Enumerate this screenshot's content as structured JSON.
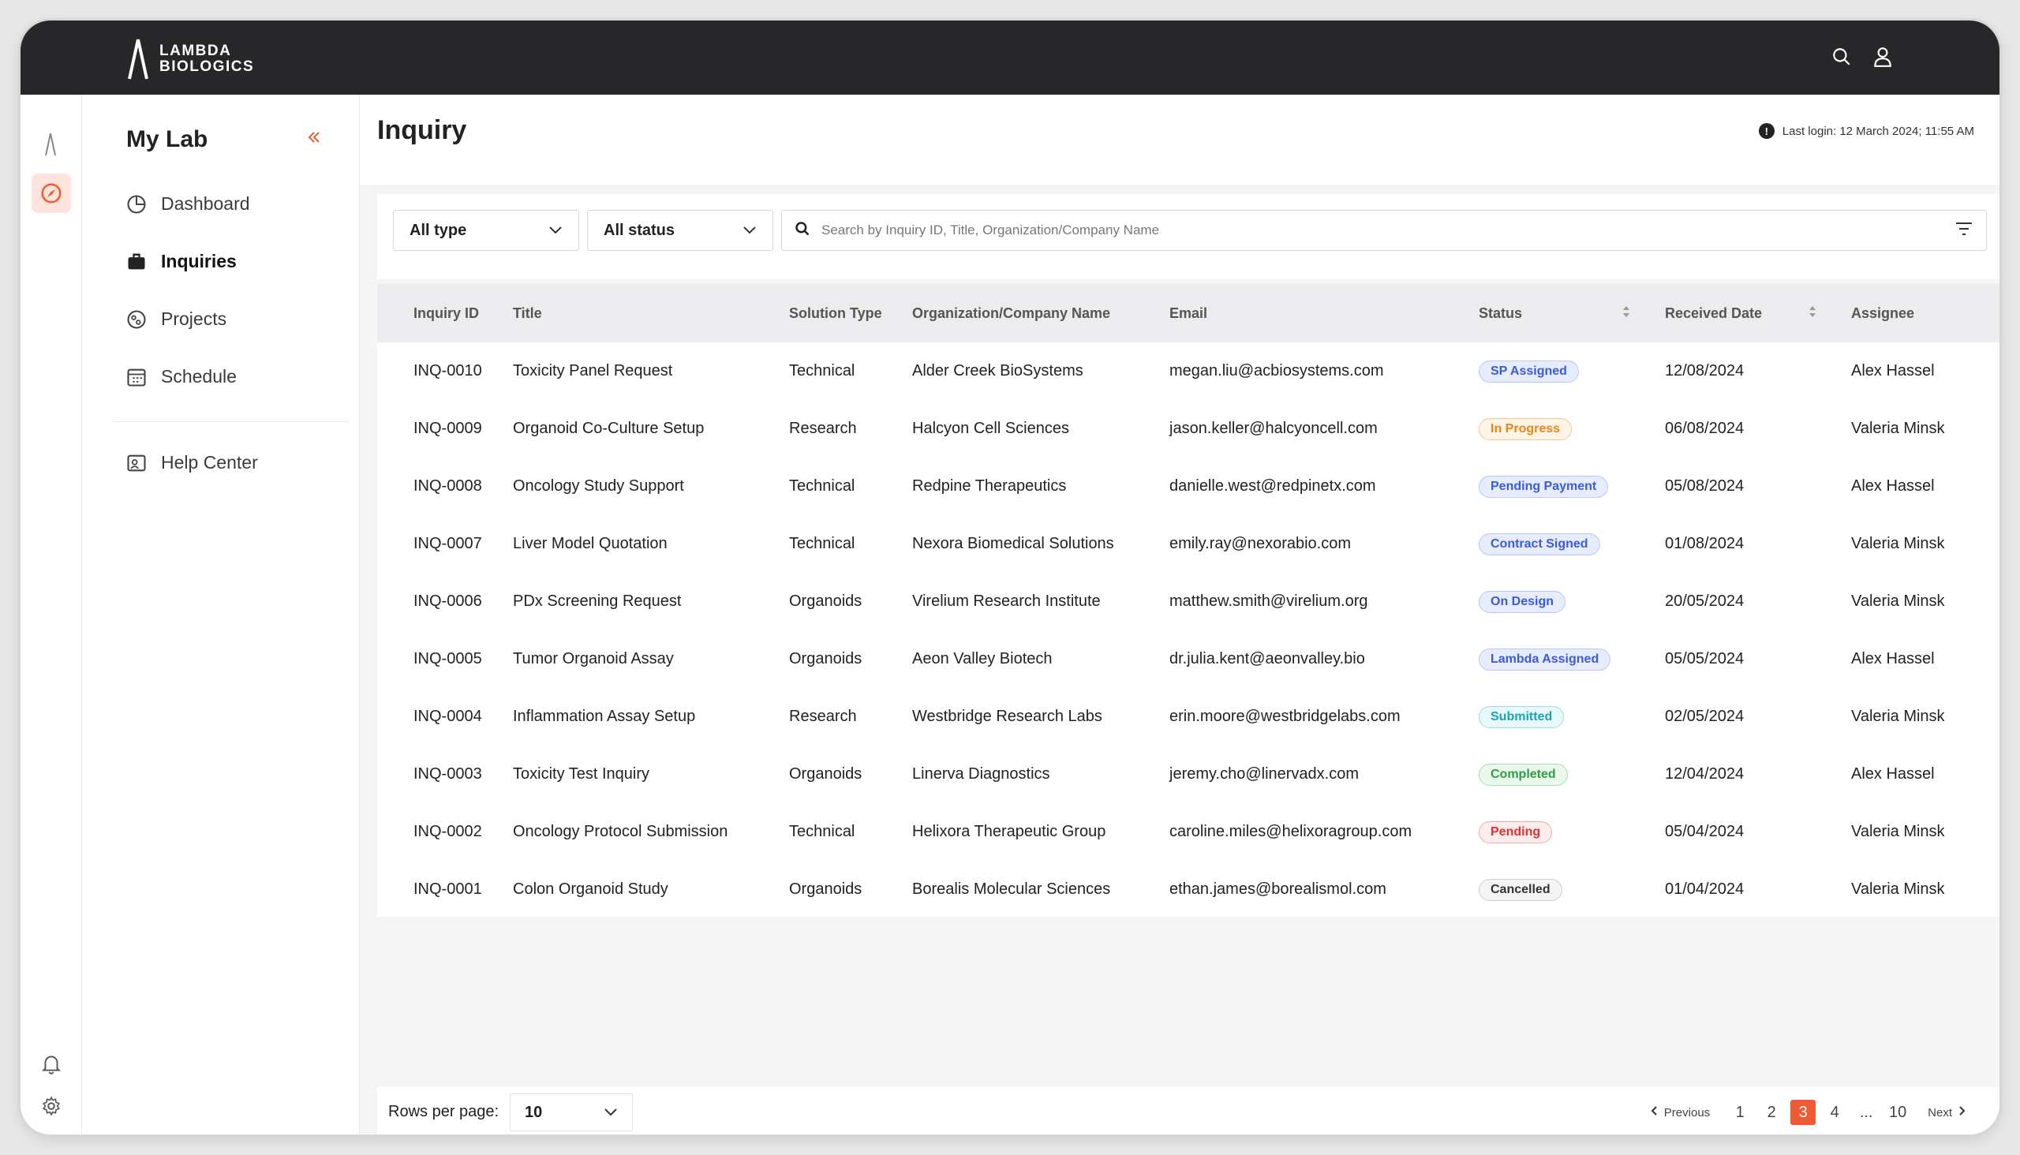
{
  "brand": {
    "line1": "LAMBDA",
    "line2": "BIOLOGICS"
  },
  "sidebar": {
    "title": "My Lab",
    "items": [
      {
        "label": "Dashboard",
        "icon": "dashboard-icon"
      },
      {
        "label": "Inquiries",
        "icon": "briefcase-icon",
        "active": true
      },
      {
        "label": "Projects",
        "icon": "projects-icon"
      },
      {
        "label": "Schedule",
        "icon": "calendar-icon"
      }
    ],
    "help": {
      "label": "Help Center",
      "icon": "help-center-icon"
    }
  },
  "header": {
    "title": "Inquiry",
    "last_login": "Last login: 12 March 2024; 11:55 AM"
  },
  "filters": {
    "type": "All type",
    "status": "All status",
    "search_placeholder": "Search by Inquiry ID, Title, Organization/Company Name"
  },
  "table": {
    "headers": {
      "id": "Inquiry ID",
      "title": "Title",
      "type": "Solution Type",
      "org": "Organization/Company Name",
      "email": "Email",
      "status": "Status",
      "date": "Received Date",
      "assignee": "Assignee"
    },
    "rows": [
      {
        "id": "INQ-0010",
        "title": "Toxicity Panel Request",
        "type": "Technical",
        "org": "Alder Creek BioSystems",
        "email": "megan.liu@acbiosystems.com",
        "status": "SP Assigned",
        "date": "12/08/2024",
        "assignee": "Alex Hassel"
      },
      {
        "id": "INQ-0009",
        "title": "Organoid Co-Culture Setup",
        "type": "Research",
        "org": "Halcyon Cell Sciences",
        "email": "jason.keller@halcyoncell.com",
        "status": "In Progress",
        "date": "06/08/2024",
        "assignee": "Valeria Minsk"
      },
      {
        "id": "INQ-0008",
        "title": "Oncology Study Support",
        "type": "Technical",
        "org": "Redpine Therapeutics",
        "email": "danielle.west@redpinetx.com",
        "status": "Pending Payment",
        "date": "05/08/2024",
        "assignee": "Alex Hassel"
      },
      {
        "id": "INQ-0007",
        "title": "Liver Model Quotation",
        "type": "Technical",
        "org": "Nexora Biomedical Solutions",
        "email": "emily.ray@nexorabio.com",
        "status": "Contract Signed",
        "date": "01/08/2024",
        "assignee": "Valeria Minsk"
      },
      {
        "id": "INQ-0006",
        "title": "PDx Screening Request",
        "type": "Organoids",
        "org": "Virelium Research Institute",
        "email": "matthew.smith@virelium.org",
        "status": "On Design",
        "date": "20/05/2024",
        "assignee": "Valeria Minsk"
      },
      {
        "id": "INQ-0005",
        "title": "Tumor Organoid Assay",
        "type": "Organoids",
        "org": "Aeon Valley Biotech",
        "email": "dr.julia.kent@aeonvalley.bio",
        "status": "Lambda Assigned",
        "date": "05/05/2024",
        "assignee": "Alex Hassel"
      },
      {
        "id": "INQ-0004",
        "title": "Inflammation Assay Setup",
        "type": "Research",
        "org": "Westbridge Research Labs",
        "email": "erin.moore@westbridgelabs.com",
        "status": "Submitted",
        "date": "02/05/2024",
        "assignee": "Valeria Minsk"
      },
      {
        "id": "INQ-0003",
        "title": "Toxicity Test Inquiry",
        "type": "Organoids",
        "org": "Linerva Diagnostics",
        "email": "jeremy.cho@linervadx.com",
        "status": "Completed",
        "date": "12/04/2024",
        "assignee": "Alex Hassel"
      },
      {
        "id": "INQ-0002",
        "title": "Oncology Protocol Submission",
        "type": "Technical",
        "org": "Helixora Therapeutic Group",
        "email": "caroline.miles@helixoragroup.com",
        "status": "Pending",
        "date": "05/04/2024",
        "assignee": "Valeria Minsk"
      },
      {
        "id": "INQ-0001",
        "title": "Colon Organoid Study",
        "type": "Organoids",
        "org": "Borealis Molecular Sciences",
        "email": "ethan.james@borealismol.com",
        "status": "Cancelled",
        "date": "01/04/2024",
        "assignee": "Valeria Minsk"
      }
    ]
  },
  "status_colors": {
    "SP Assigned": {
      "fg": "#3b5bdb",
      "bg": "#e7ecfd",
      "border": "#b9c6f6"
    },
    "In Progress": {
      "fg": "#e8861a",
      "bg": "#fff4e6",
      "border": "#f6c98a"
    },
    "Pending Payment": {
      "fg": "#3b5bdb",
      "bg": "#e7ecfd",
      "border": "#b9c6f6"
    },
    "Contract Signed": {
      "fg": "#3b5bdb",
      "bg": "#e7ecfd",
      "border": "#b9c6f6"
    },
    "On Design": {
      "fg": "#3b5bdb",
      "bg": "#e7ecfd",
      "border": "#b9c6f6"
    },
    "Lambda Assigned": {
      "fg": "#3b5bdb",
      "bg": "#e7ecfd",
      "border": "#b9c6f6"
    },
    "Submitted": {
      "fg": "#1aa3b8",
      "bg": "#e6f8fa",
      "border": "#9edce6"
    },
    "Completed": {
      "fg": "#2f9e44",
      "bg": "#e9f7ec",
      "border": "#a8dcb3"
    },
    "Pending": {
      "fg": "#e03131",
      "bg": "#fdecec",
      "border": "#f3aaaa"
    },
    "Cancelled": {
      "fg": "#333333",
      "bg": "#f4f4f4",
      "border": "#cfcfcf"
    }
  },
  "pagination": {
    "rows_label": "Rows per page:",
    "rows_value": "10",
    "previous": "Previous",
    "next": "Next",
    "pages": [
      "1",
      "2",
      "3",
      "4",
      "...",
      "10"
    ],
    "current": "3"
  },
  "accent": "#ee5a32"
}
